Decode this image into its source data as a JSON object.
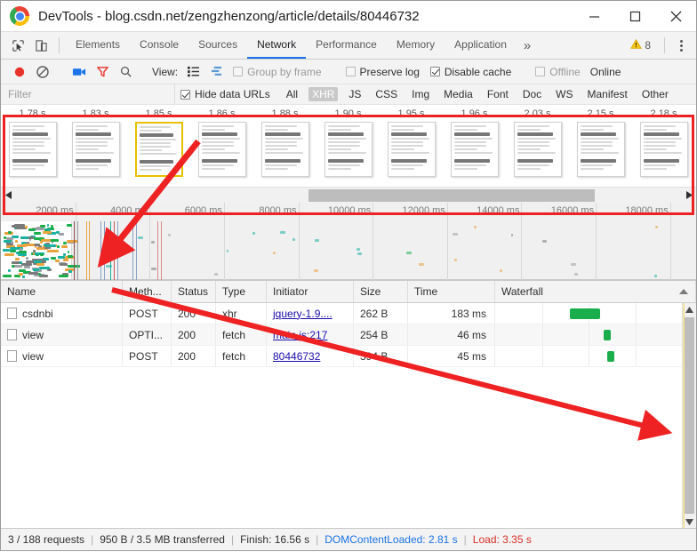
{
  "window": {
    "title": "DevTools - blog.csdn.net/zengzhenzong/article/details/80446732",
    "minimize_label": "Minimize",
    "maximize_label": "Maximize",
    "close_label": "Close",
    "logo_name": "chrome-logo"
  },
  "devtools_tabs": {
    "inspect_icon": "inspect-element-icon",
    "device_icon": "device-toolbar-icon",
    "items": [
      {
        "label": "Elements",
        "active": false
      },
      {
        "label": "Console",
        "active": false
      },
      {
        "label": "Sources",
        "active": false
      },
      {
        "label": "Network",
        "active": true
      },
      {
        "label": "Performance",
        "active": false
      },
      {
        "label": "Memory",
        "active": false
      },
      {
        "label": "Application",
        "active": false
      }
    ],
    "more_label": "»",
    "warning_count": "8",
    "warning_icon": "warning-triangle-icon",
    "menu_icon": "kebab-menu-icon"
  },
  "network_toolbar": {
    "record_icon": "record-button-icon",
    "clear_icon": "clear-icon",
    "capture_screenshots_icon": "camera-icon",
    "filter_icon": "filter-funnel-icon",
    "search_icon": "search-icon",
    "view_label": "View:",
    "list_view_icon": "list-view-icon",
    "waterfall_view_icon": "waterfall-view-icon",
    "group_by_frame": {
      "label": "Group by frame",
      "checked": false,
      "enabled": false
    },
    "preserve_log": {
      "label": "Preserve log",
      "checked": false,
      "enabled": true
    },
    "disable_cache": {
      "label": "Disable cache",
      "checked": true,
      "enabled": true
    },
    "offline": {
      "label": "Offline",
      "checked": false,
      "enabled": false
    },
    "online_label": "Online"
  },
  "filter_bar": {
    "placeholder": "Filter",
    "value": "",
    "hide_data_urls": {
      "label": "Hide data URLs",
      "checked": true
    },
    "types": [
      {
        "label": "All",
        "selected": false
      },
      {
        "label": "XHR",
        "selected": true
      },
      {
        "label": "JS",
        "selected": false
      },
      {
        "label": "CSS",
        "selected": false
      },
      {
        "label": "Img",
        "selected": false
      },
      {
        "label": "Media",
        "selected": false
      },
      {
        "label": "Font",
        "selected": false
      },
      {
        "label": "Doc",
        "selected": false
      },
      {
        "label": "WS",
        "selected": false
      },
      {
        "label": "Manifest",
        "selected": false
      },
      {
        "label": "Other",
        "selected": false
      }
    ]
  },
  "filmstrip": {
    "frames": [
      {
        "time": "1.78 s",
        "selected": false
      },
      {
        "time": "1.83 s",
        "selected": false
      },
      {
        "time": "1.85 s",
        "selected": true
      },
      {
        "time": "1.86 s",
        "selected": false
      },
      {
        "time": "1.88 s",
        "selected": false
      },
      {
        "time": "1.90 s",
        "selected": false
      },
      {
        "time": "1.95 s",
        "selected": false
      },
      {
        "time": "1.96 s",
        "selected": false
      },
      {
        "time": "2.03 s",
        "selected": false
      },
      {
        "time": "2.15 s",
        "selected": false
      },
      {
        "time": "2.18 s",
        "selected": false
      }
    ],
    "scroll_left_icon": "scroll-left-arrow-icon",
    "scroll_right_icon": "scroll-right-arrow-icon",
    "highlight_color": "#ee2222"
  },
  "overview": {
    "ticks": [
      "2000 ms",
      "4000 ms",
      "6000 ms",
      "8000 ms",
      "10000 ms",
      "12000 ms",
      "14000 ms",
      "16000 ms",
      "18000 ms"
    ]
  },
  "table": {
    "columns": [
      {
        "key": "name",
        "label": "Name"
      },
      {
        "key": "method",
        "label": "Meth..."
      },
      {
        "key": "status",
        "label": "Status"
      },
      {
        "key": "type",
        "label": "Type"
      },
      {
        "key": "initiator",
        "label": "Initiator"
      },
      {
        "key": "size",
        "label": "Size"
      },
      {
        "key": "time",
        "label": "Time"
      },
      {
        "key": "waterfall",
        "label": "Waterfall"
      }
    ],
    "rows": [
      {
        "name": "csdnbi",
        "method": "POST",
        "status": "200",
        "type": "xhr",
        "initiator": "jquery-1.9....",
        "size": "262 B",
        "time": "183 ms",
        "wf_left_pct": 40,
        "wf_width_pct": 16
      },
      {
        "name": "view",
        "method": "OPTI...",
        "status": "200",
        "type": "fetch",
        "initiator": "main.js:217",
        "size": "254 B",
        "time": "46 ms",
        "wf_left_pct": 58,
        "wf_width_pct": 4
      },
      {
        "name": "view",
        "method": "POST",
        "status": "200",
        "type": "fetch",
        "initiator": "80446732",
        "size": "394 B",
        "time": "45 ms",
        "wf_left_pct": 60,
        "wf_width_pct": 4
      }
    ]
  },
  "status_bar": {
    "requests": "3 / 188 requests",
    "transferred": "950 B / 3.5 MB transferred",
    "finish": "Finish: 16.56 s",
    "dom_content_loaded": "DOMContentLoaded: 2.81 s",
    "load": "Load: 3.35 s",
    "separator": "|",
    "dcl_color": "#1a73e8",
    "load_color": "#d93025"
  },
  "annotations": {
    "arrow_color": "#ee2222",
    "arrow_1_name": "annotation-arrow-to-overview",
    "arrow_2_name": "annotation-arrow-to-waterfall"
  }
}
